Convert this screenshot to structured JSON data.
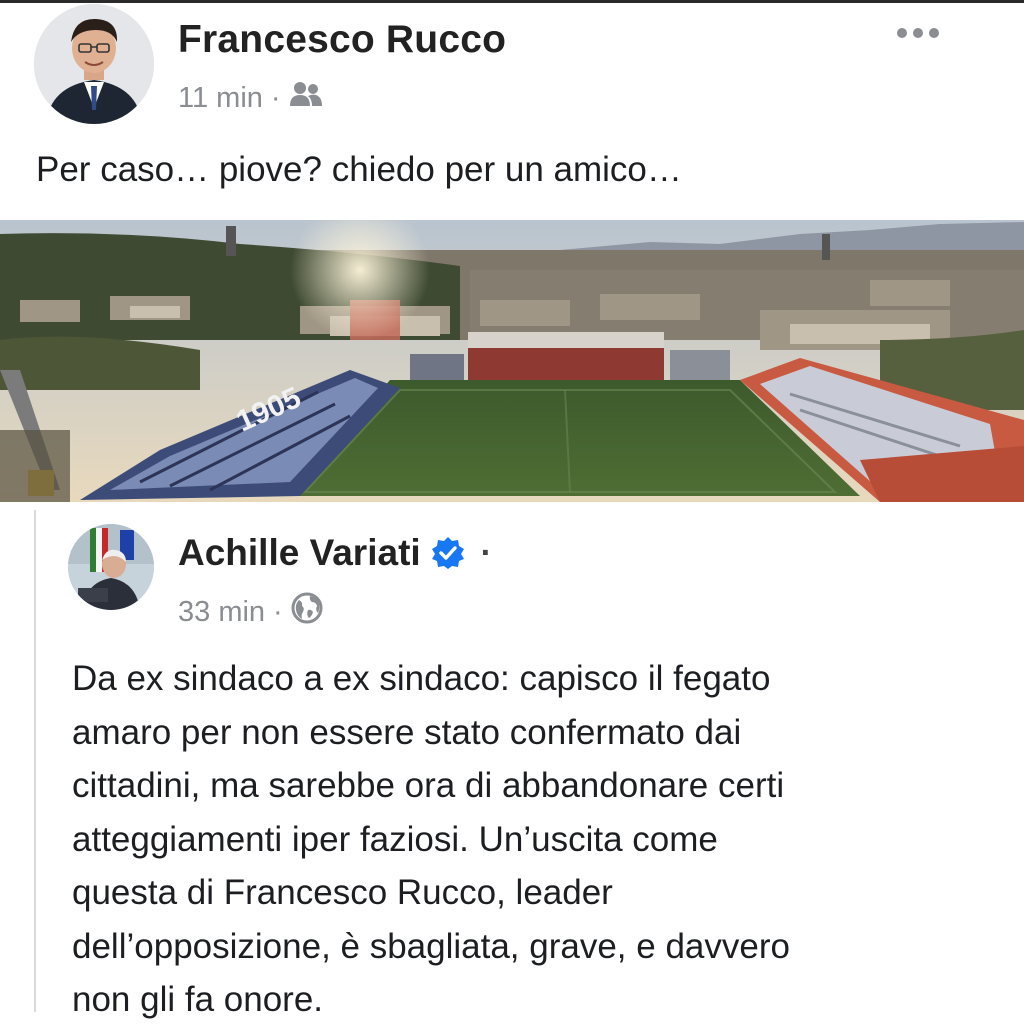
{
  "post": {
    "author": "Francesco Rucco",
    "time": "11 min",
    "separator": "·",
    "audience_icon": "friends-icon",
    "more_icon": "more-horizontal-icon",
    "text": "Per caso… piove? chiedo per un amico…"
  },
  "photo": {
    "subject": "stadium-aerial-photo",
    "stand_lettering": "1905"
  },
  "shared_post": {
    "author": "Achille Variati",
    "verified_icon": "verified-badge-icon",
    "separator": "·",
    "time": "33 min",
    "audience_icon": "globe-icon",
    "text_lines": [
      "Da ex sindaco a ex sindaco: capisco il fegato",
      "amaro per non essere stato confermato dai",
      "cittadini, ma sarebbe ora di abbandonare certi",
      "atteggiamenti iper faziosi. Un’uscita come",
      "questa di Francesco Rucco, leader",
      "dell’opposizione, è sbagliata, grave, e davvero",
      "non gli fa onore."
    ]
  },
  "colors": {
    "text": "#1c1e21",
    "meta": "#8a8d91",
    "verified": "#1877f2"
  }
}
